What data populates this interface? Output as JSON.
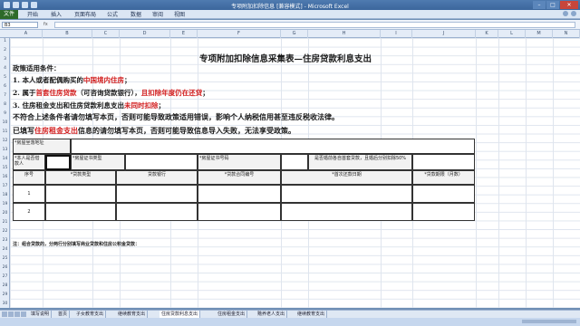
{
  "window": {
    "title": "专项附加扣除信息  [兼容模式] - Microsoft Excel"
  },
  "ribbon": {
    "file_label": "文件",
    "tabs": [
      "开始",
      "插入",
      "页面布局",
      "公式",
      "数据",
      "审阅",
      "视图"
    ]
  },
  "formula_bar": {
    "name_box": "B3",
    "fx": "fx",
    "content": ""
  },
  "columns": [
    "A",
    "B",
    "C",
    "D",
    "E",
    "F",
    "G",
    "H",
    "I",
    "J",
    "K",
    "L",
    "M",
    "N"
  ],
  "rows": [
    "1",
    "2",
    "3",
    "4",
    "5",
    "6",
    "7",
    "8",
    "9",
    "10",
    "11",
    "12",
    "13",
    "14",
    "15",
    "16",
    "17",
    "18",
    "19",
    "20",
    "21",
    "22",
    "23",
    "24",
    "25",
    "26",
    "27",
    "28",
    "29",
    "30"
  ],
  "form": {
    "title": "专项附加扣除信息采集表—住房贷款利息支出",
    "policy_heading": "政策适用条件：",
    "cond1_a": "1. 本人或者配偶购买的",
    "cond1_red": "中国境内住房",
    "cond1_b": "；",
    "cond2_a": "2. 属于",
    "cond2_red1": "首套住房贷款",
    "cond2_b": "（可咨询贷款银行），",
    "cond2_red2": "且扣除年度仍在还贷",
    "cond2_c": "；",
    "cond3_a": "3. 住房租金支出和住房贷款利息支出",
    "cond3_red": "未同时扣除",
    "cond3_b": "；",
    "warning": "不符合上述条件者请勿填写本页，否则可能导致政策适用错误，影响个人纳税信用甚至违反税收法律。",
    "filled_a": "已填写",
    "filled_red": "住房租金支出",
    "filled_b": "信息的请勿填写本页，否则可能导致信息导入失败，无法享受政策。",
    "table": {
      "house_address": "*房屋坐落地址",
      "is_borrower": "*本人是否借款人",
      "cert_type": "*房屋证书类型",
      "cert_no": "*房屋证书号码",
      "first_loan_q": "是否婚前各自首套贷款，且婚后分别扣除50%",
      "col_no": "序号",
      "col_loan_type": "*贷款类型",
      "col_bank": "贷款银行",
      "col_contract": "*贷款合同编号",
      "col_first_date": "*首次还款日期",
      "col_term": "*贷款期限（月数）",
      "row1": "1",
      "row2": "2"
    },
    "note": "注：组合贷款的，分两行分别填写商业贷款和住房公积金贷款："
  },
  "sheet_tabs": [
    "填写说明",
    "首页",
    "子女教育支出",
    "继续教育支出",
    "住房贷款利息支出",
    "住房租金支出",
    "赡养老人支出",
    "继续教育支出"
  ],
  "active_sheet_index": 4
}
